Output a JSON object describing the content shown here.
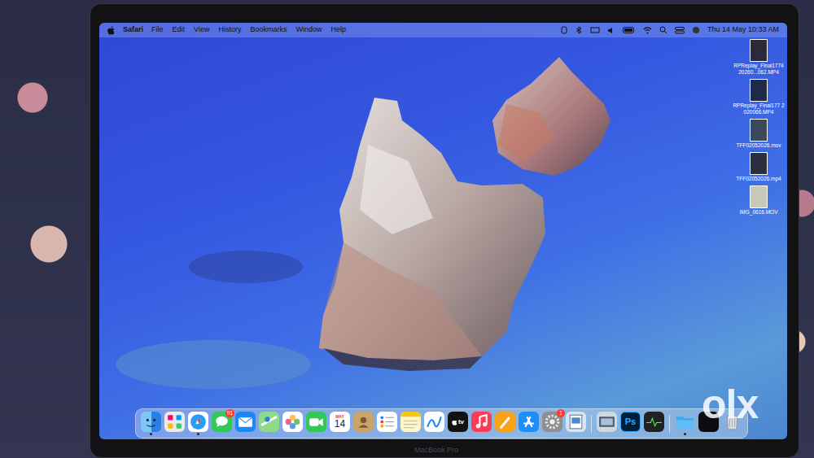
{
  "menu_bar": {
    "app": "Safari",
    "items": [
      "File",
      "Edit",
      "View",
      "History",
      "Bookmarks",
      "Window",
      "Help"
    ],
    "clock": "Thu 14 May 10:33 AM"
  },
  "desktop_icons": [
    {
      "label": "RPReplay_Final1774 20260...062.MP4"
    },
    {
      "label": "RPReplay_Final177 2020066.MP4"
    },
    {
      "label": "TFF02052026.mov"
    },
    {
      "label": "TFF02052026.mp4"
    },
    {
      "label": "IMG_0616.MOV"
    }
  ],
  "dock": {
    "items": [
      {
        "kind": "finder",
        "running": true
      },
      {
        "kind": "launchpad",
        "running": false
      },
      {
        "kind": "safari",
        "running": true
      },
      {
        "kind": "messages",
        "running": false,
        "badge": "91"
      },
      {
        "kind": "mail",
        "running": false
      },
      {
        "kind": "maps",
        "running": false
      },
      {
        "kind": "photos",
        "running": false
      },
      {
        "kind": "facetime",
        "running": false
      },
      {
        "kind": "calendar",
        "running": false,
        "month": "MAY",
        "day": "14"
      },
      {
        "kind": "contacts",
        "running": false
      },
      {
        "kind": "reminders",
        "running": false
      },
      {
        "kind": "notes",
        "running": false
      },
      {
        "kind": "freeform",
        "running": false
      },
      {
        "kind": "tv",
        "running": false,
        "label": "tv"
      },
      {
        "kind": "music",
        "running": false
      },
      {
        "kind": "pages",
        "running": false
      },
      {
        "kind": "appstore",
        "running": false
      },
      {
        "kind": "settings",
        "running": false,
        "badge": "1"
      },
      {
        "kind": "preview",
        "running": false
      },
      {
        "kind": "separator",
        "running": false
      },
      {
        "kind": "image",
        "running": false
      },
      {
        "kind": "photoshop",
        "running": false,
        "label": "Ps"
      },
      {
        "kind": "activity",
        "running": false
      },
      {
        "kind": "separator",
        "running": false
      },
      {
        "kind": "folder",
        "running": true
      },
      {
        "kind": "blank",
        "running": false
      },
      {
        "kind": "trash",
        "running": false
      }
    ]
  },
  "watermark": "olx",
  "bezel_label": "MacBook Pro"
}
